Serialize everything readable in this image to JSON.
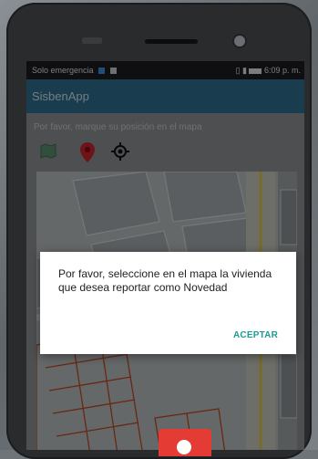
{
  "statusbar": {
    "carrier": "Solo emergencia",
    "time": "6:09 p. m."
  },
  "appbar": {
    "title": "SisbenApp"
  },
  "main": {
    "instruction": "Por favor, marque su posición en el mapa",
    "tools": [
      {
        "icon": "map-icon"
      },
      {
        "icon": "marker-icon"
      },
      {
        "icon": "gps-icon"
      }
    ]
  },
  "dialog": {
    "message": "Por favor, seleccione en el mapa la vivienda que desea reportar como Novedad",
    "accept_label": "ACEPTAR"
  },
  "colors": {
    "appbar": "#2f6d8e",
    "accent": "#1d9c92",
    "marker": "#e53b35",
    "parcel_lines": "#c0471f",
    "road_yellow": "#d8c54a"
  }
}
